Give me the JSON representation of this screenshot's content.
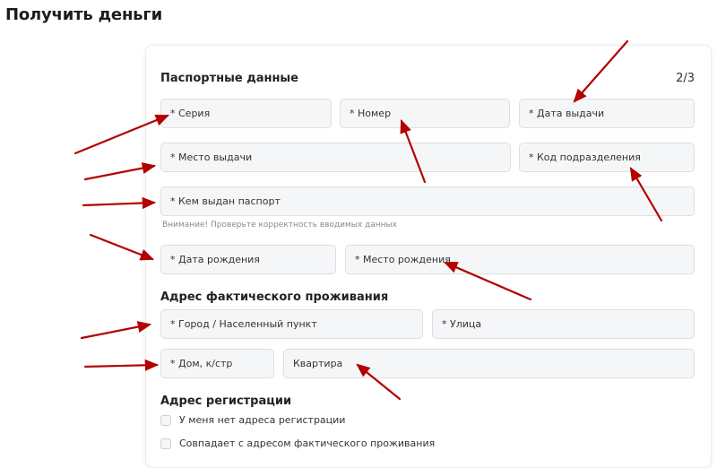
{
  "page": {
    "title": "Получить деньги"
  },
  "form": {
    "step": "2/3",
    "passport": {
      "title": "Паспортные данные",
      "series": "* Серия",
      "number": "* Номер",
      "issue_date": "* Дата выдачи",
      "issue_place": "* Место выдачи",
      "division_code": "* Код подразделения",
      "issued_by": "* Кем выдан паспорт",
      "hint": "Внимание! Проверьте корректность вводимых данных",
      "birth_date": "* Дата рождения",
      "birth_place": "* Место рождения"
    },
    "actual_address": {
      "title": "Адрес фактического проживания",
      "city": "* Город / Населенный пункт",
      "street": "* Улица",
      "house": "* Дом, к/стр",
      "apartment": "Квартира"
    },
    "registration_address": {
      "title": "Адрес регистрации",
      "no_registration": "У меня нет адреса регистрации",
      "same_as_actual": "Совпадает с адресом фактического проживания"
    }
  },
  "annotation_arrow_color": "#b30000"
}
